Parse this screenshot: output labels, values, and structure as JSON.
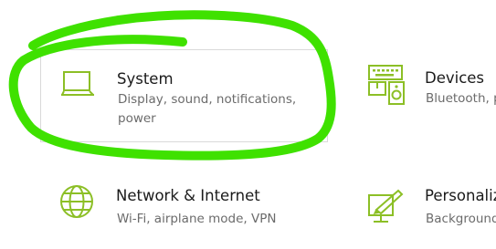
{
  "accent_color": "#8cbf26",
  "highlight_color": "#3fe100",
  "categories": [
    {
      "title": "System",
      "description": "Display, sound, notifications, power",
      "icon": "laptop-icon",
      "selected": true
    },
    {
      "title": "Devices",
      "description": "Bluetooth, pri",
      "icon": "devices-icon"
    },
    {
      "title": "Network & Internet",
      "description": "Wi-Fi, airplane mode, VPN",
      "icon": "globe-icon"
    },
    {
      "title": "Personaliza",
      "description": "Background,",
      "icon": "personalization-icon"
    }
  ]
}
